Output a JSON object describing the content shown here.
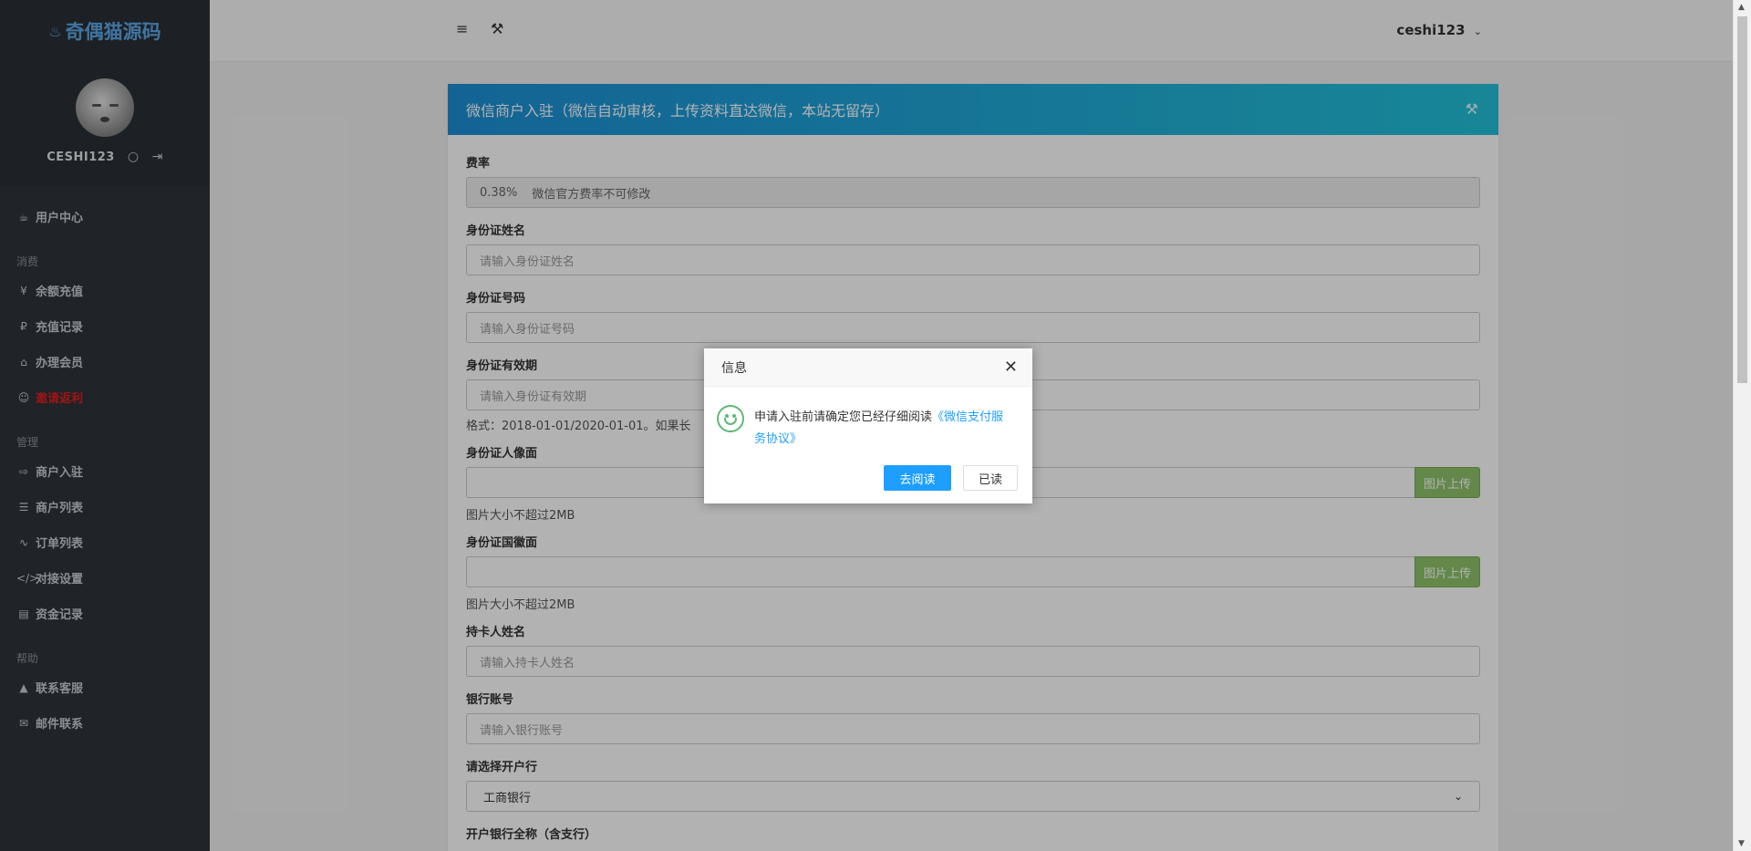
{
  "brand": {
    "icon": "flame-icon",
    "name": "奇偶猫源码"
  },
  "profile": {
    "username": "CESHI123"
  },
  "nav": {
    "user_center": "用户中心",
    "section_consume": "消费",
    "recharge": "余额充值",
    "recharge_records": "充值记录",
    "membership": "办理会员",
    "invite_rebate": "邀请返利",
    "section_manage": "管理",
    "merchant_entry": "商户入驻",
    "merchant_list": "商户列表",
    "order_list": "订单列表",
    "api_settings": "对接设置",
    "fund_records": "资金记录",
    "section_help": "帮助",
    "contact_service": "联系客服",
    "email_contact": "邮件联系"
  },
  "header": {
    "user": "ceshi123"
  },
  "panel": {
    "title": "微信商户入驻（微信自动审核，上传资料直达微信，本站无留存）",
    "fee_label": "费率",
    "fee_value": "0.38%",
    "fee_note": "微信官方费率不可修改",
    "id_name_label": "身份证姓名",
    "id_name_placeholder": "请输入身份证姓名",
    "id_number_label": "身份证号码",
    "id_number_placeholder": "请输入身份证号码",
    "id_validity_label": "身份证有效期",
    "id_validity_placeholder": "请输入身份证有效期",
    "id_validity_hint": "格式：2018-01-01/2020-01-01。如果长",
    "id_front_label": "身份证人像面",
    "upload_label": "图片上传",
    "size_hint": "图片大小不超过2MB",
    "id_back_label": "身份证国徽面",
    "cardholder_label": "持卡人姓名",
    "cardholder_placeholder": "请输入持卡人姓名",
    "bank_account_label": "银行账号",
    "bank_account_placeholder": "请输入银行账号",
    "bank_select_label": "请选择开户行",
    "bank_selected": "工商银行",
    "next_label": "开户银行全称（含支行）"
  },
  "dialog": {
    "title": "信息",
    "message": "申请入驻前请确定您已经仔细阅读",
    "link": "《微信支付服务协议》",
    "btn_read": "去阅读",
    "btn_done": "已读"
  }
}
